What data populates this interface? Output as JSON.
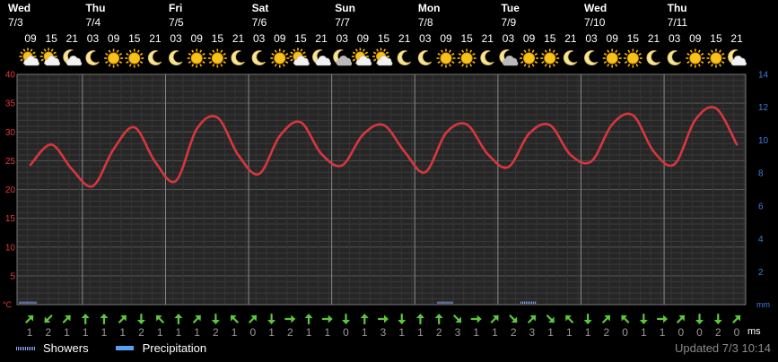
{
  "days": [
    {
      "name": "Wed",
      "date": "7/3"
    },
    {
      "name": "Thu",
      "date": "7/4"
    },
    {
      "name": "Fri",
      "date": "7/5"
    },
    {
      "name": "Sat",
      "date": "7/6"
    },
    {
      "name": "Sun",
      "date": "7/7"
    },
    {
      "name": "Mon",
      "date": "7/8"
    },
    {
      "name": "Tue",
      "date": "7/9"
    },
    {
      "name": "Wed",
      "date": "7/10"
    },
    {
      "name": "Thu",
      "date": "7/11"
    }
  ],
  "hours": [
    "09",
    "15",
    "21",
    "03",
    "09",
    "15",
    "21",
    "03",
    "09",
    "15",
    "21",
    "03",
    "09",
    "15",
    "21",
    "03",
    "09",
    "15",
    "21",
    "03",
    "09",
    "15",
    "21",
    "03",
    "09",
    "15",
    "21",
    "03",
    "09",
    "15",
    "21",
    "03",
    "09",
    "15",
    "21"
  ],
  "weather_icons": [
    "sun-cloud-icon",
    "sun-cloud-icon",
    "moon-cloud-icon",
    "moon-icon",
    "sun-icon",
    "sun-icon",
    "moon-icon",
    "moon-icon",
    "sun-icon",
    "sun-icon",
    "moon-icon",
    "moon-icon",
    "sun-icon",
    "sun-cloud-icon",
    "moon-cloud-icon",
    "moon-cloud-grey-icon",
    "sun-cloud-icon",
    "sun-cloud-icon",
    "moon-icon",
    "moon-icon",
    "sun-icon",
    "sun-icon",
    "moon-icon",
    "moon-cloud-grey-icon",
    "sun-icon",
    "sun-icon",
    "moon-icon",
    "moon-icon",
    "sun-icon",
    "sun-icon",
    "moon-icon",
    "moon-icon",
    "sun-icon",
    "sun-icon",
    "moon-cloud-icon"
  ],
  "wind": {
    "speeds": [
      "1",
      "2",
      "1",
      "1",
      "1",
      "1",
      "2",
      "1",
      "1",
      "1",
      "2",
      "1",
      "0",
      "1",
      "2",
      "1",
      "1",
      "0",
      "1",
      "3",
      "1",
      "1",
      "2",
      "3",
      "1",
      "1",
      "2",
      "3",
      "1",
      "1",
      "1",
      "2",
      "0",
      "1",
      "1",
      "0",
      "0",
      "2",
      "0"
    ],
    "directions_deg": [
      45,
      225,
      45,
      0,
      0,
      45,
      180,
      315,
      0,
      45,
      180,
      315,
      45,
      180,
      90,
      0,
      90,
      180,
      0,
      90,
      180,
      0,
      0,
      135,
      90,
      45,
      135,
      45,
      135,
      315,
      180,
      45,
      315,
      180,
      90,
      45,
      180,
      180,
      45
    ],
    "unit": "ms"
  },
  "legend": {
    "showers": "Showers",
    "precipitation": "Precipitation"
  },
  "updated": "Updated 7/3 10:14",
  "colors": {
    "temperature": "#d8363e",
    "precipitation": "#5aa0f0",
    "left_axis": "#e23a3a",
    "right_axis": "#3a7fe0"
  },
  "chart_data": {
    "type": "line",
    "x": [
      "7/3 09",
      "7/3 15",
      "7/3 21",
      "7/4 03",
      "7/4 09",
      "7/4 15",
      "7/4 21",
      "7/5 03",
      "7/5 09",
      "7/5 15",
      "7/5 21",
      "7/6 03",
      "7/6 09",
      "7/6 15",
      "7/6 21",
      "7/7 03",
      "7/7 09",
      "7/7 15",
      "7/7 21",
      "7/8 03",
      "7/8 09",
      "7/8 15",
      "7/8 21",
      "7/9 03",
      "7/9 09",
      "7/9 15",
      "7/9 21",
      "7/10 03",
      "7/10 09",
      "7/10 15",
      "7/10 21",
      "7/11 03",
      "7/11 09",
      "7/11 15",
      "7/11 21"
    ],
    "series": [
      {
        "values": [
          24.3,
          27.8,
          23.5,
          20.6,
          27.0,
          30.8,
          24.8,
          21.5,
          30.5,
          32.5,
          26.0,
          22.7,
          29.3,
          31.7,
          26.2,
          24.2,
          29.5,
          31.2,
          26.6,
          23.0,
          29.8,
          31.3,
          26.2,
          23.9,
          29.7,
          31.2,
          26.0,
          24.9,
          31.3,
          32.9,
          26.6,
          24.4,
          32.1,
          34.1,
          27.8
        ]
      }
    ],
    "precipitation": [
      {
        "kind": "showers",
        "x_index": 0,
        "value": 0.1
      },
      {
        "kind": "showers",
        "x_index": 20,
        "value": 0.05
      },
      {
        "kind": "showers",
        "x_index": 24,
        "value": 0.05
      }
    ],
    "ylabel_left": "°C",
    "ylabel_right": "mm",
    "ylim": [
      0,
      40
    ],
    "yticks_left": [
      5,
      10,
      15,
      20,
      25,
      30,
      35,
      40
    ],
    "ylim_right": [
      0,
      14
    ],
    "yticks_right": [
      2,
      4,
      6,
      8,
      10,
      12,
      14
    ],
    "grid": true
  }
}
